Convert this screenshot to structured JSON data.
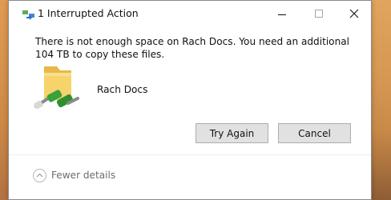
{
  "window": {
    "title": "1 Interrupted Action",
    "controls": [
      "minimize",
      "maximize",
      "close"
    ]
  },
  "dialog": {
    "message": "There is not enough space on Rach Docs. You need an additional 104 TB to copy these files.",
    "item": {
      "name": "Rach Docs",
      "icon": "folder-with-network-icon"
    },
    "buttons": {
      "try_again": "Try Again",
      "cancel": "Cancel"
    },
    "details_toggle": "Fewer details"
  },
  "colors": {
    "button_bg": "#e1e1e1",
    "button_border": "#adadad",
    "folder_yellow": "#f6d36b",
    "network_green": "#3aa23a"
  }
}
